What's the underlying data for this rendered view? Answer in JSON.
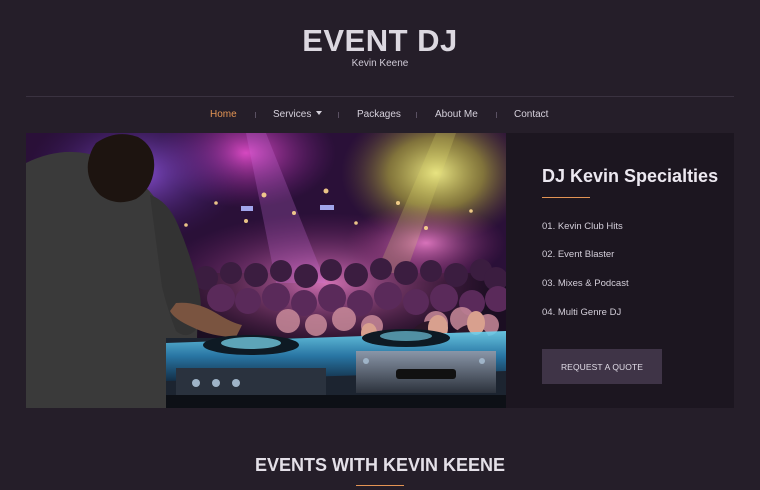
{
  "header": {
    "title": "EVENT DJ",
    "tagline": "Kevin Keene"
  },
  "nav": {
    "items": [
      {
        "label": "Home",
        "active": true
      },
      {
        "label": "Services",
        "has_dropdown": true
      },
      {
        "label": "Packages"
      },
      {
        "label": "About Me"
      },
      {
        "label": "Contact"
      }
    ]
  },
  "hero": {
    "image": "dj-at-turntables-crowd-photo"
  },
  "specialties": {
    "title": "DJ Kevin Specialties",
    "items": [
      "01. Kevin Club Hits",
      "02. Event Blaster",
      "03. Mixes & Podcast",
      "04. Multi Genre DJ"
    ],
    "cta_label": "REQUEST A QUOTE"
  },
  "events": {
    "title": "EVENTS WITH KEVIN KEENE"
  },
  "colors": {
    "background": "#251e29",
    "panel": "#1c1620",
    "accent": "#e39454",
    "button": "#3f3447"
  }
}
